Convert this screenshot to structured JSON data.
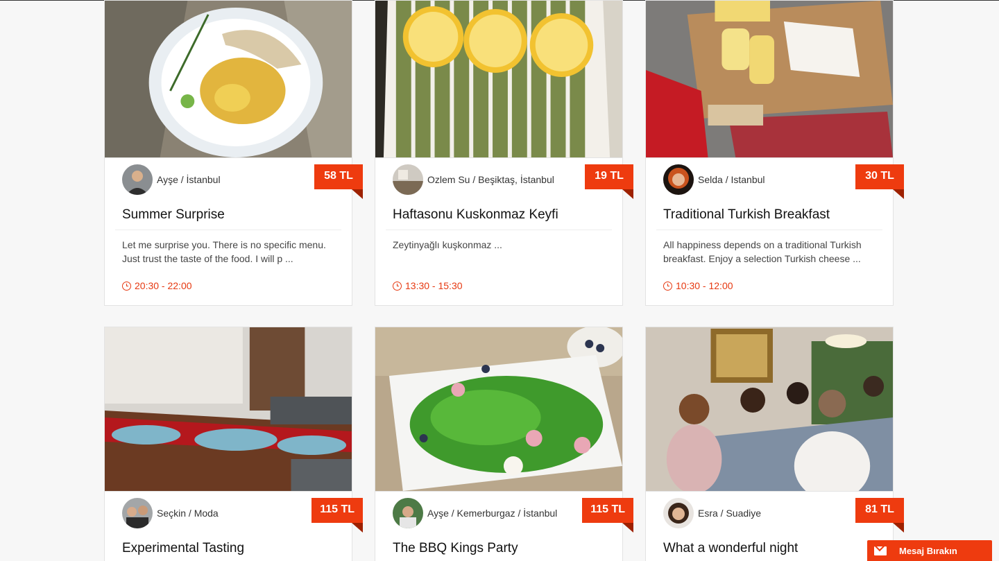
{
  "cards": [
    {
      "host": "Ayşe / İstanbul",
      "price": "58 TL",
      "title": "Summer Surprise",
      "description": "Let me surprise you. There is no specific menu. Just trust the taste of the food. I will p ...",
      "time": "20:30 - 22:00"
    },
    {
      "host": "Ozlem Su / Beşiktaş, İstanbul",
      "price": "19 TL",
      "title": "Haftasonu Kuskonmaz Keyfi",
      "description": "Zeytinyağlı kuşkonmaz ...",
      "time": "13:30 - 15:30"
    },
    {
      "host": "Selda / Istanbul",
      "price": "30 TL",
      "title": "Traditional Turkish Breakfast",
      "description": "All happiness depends on a traditional Turkish breakfast. Enjoy a selection Turkish cheese ...",
      "time": "10:30 - 12:00"
    },
    {
      "host": "Seçkin / Moda",
      "price": "115 TL",
      "title": "Experimental Tasting"
    },
    {
      "host": "Ayşe / Kemerburgaz / İstanbul",
      "price": "115 TL",
      "title": "The BBQ Kings Party"
    },
    {
      "host": "Esra / Suadiye",
      "price": "81 TL",
      "title": "What a wonderful night"
    }
  ],
  "message_button": {
    "label": "Mesaj Bırakın",
    "icon": "envelope-icon"
  },
  "colors": {
    "accent": "#ee3b0f",
    "accent_dark": "#9e2100",
    "time": "#e63810",
    "background": "#f7f7f7"
  }
}
